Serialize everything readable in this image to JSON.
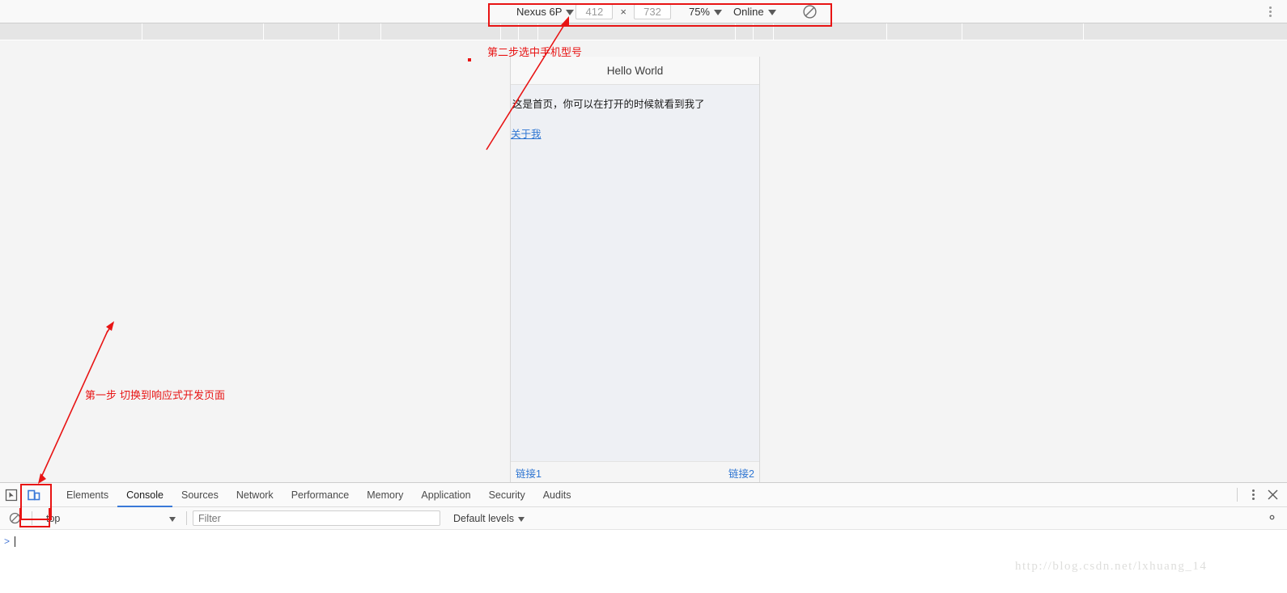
{
  "device_toolbar": {
    "device_name": "Nexus 6P",
    "width_value": "412",
    "height_value": "732",
    "dim_separator": "×",
    "zoom": "75%",
    "network": "Online",
    "rotate_icon": "rotate-icon",
    "menu_icon": "kebab-menu-icon"
  },
  "viewport": {
    "navbar_title": "Hello World",
    "body_text": "这是首页，你可以在打开的时候就看到我了",
    "about_link": "关于我",
    "footer_left_link": "链接1",
    "footer_right_link": "链接2"
  },
  "devtools": {
    "inspect_icon": "inspect-element-icon",
    "device_toggle_icon": "device-toolbar-icon",
    "tabs": [
      {
        "label": "Elements",
        "active": false
      },
      {
        "label": "Console",
        "active": true
      },
      {
        "label": "Sources",
        "active": false
      },
      {
        "label": "Network",
        "active": false
      },
      {
        "label": "Performance",
        "active": false
      },
      {
        "label": "Memory",
        "active": false
      },
      {
        "label": "Application",
        "active": false
      },
      {
        "label": "Security",
        "active": false
      },
      {
        "label": "Audits",
        "active": false
      }
    ],
    "more_icon": "kebab-menu-icon",
    "close_icon": "close-icon",
    "console": {
      "clear_icon": "clear-console-icon",
      "context": "top",
      "filter_placeholder": "Filter",
      "levels": "Default levels",
      "settings_icon": "gear-icon",
      "prompt_symbol": ">"
    }
  },
  "annotations": {
    "step1": "第一步",
    "step1_detail": "切换到响应式开发页面",
    "step2": "第二步选中手机型号",
    "color": "#e81414"
  },
  "watermark": "http://blog.csdn.net/lxhuang_14",
  "ruler": {
    "ticks": [
      175,
      325,
      418,
      470,
      618,
      640,
      664,
      908,
      930,
      955,
      1095,
      1188,
      1338
    ]
  }
}
